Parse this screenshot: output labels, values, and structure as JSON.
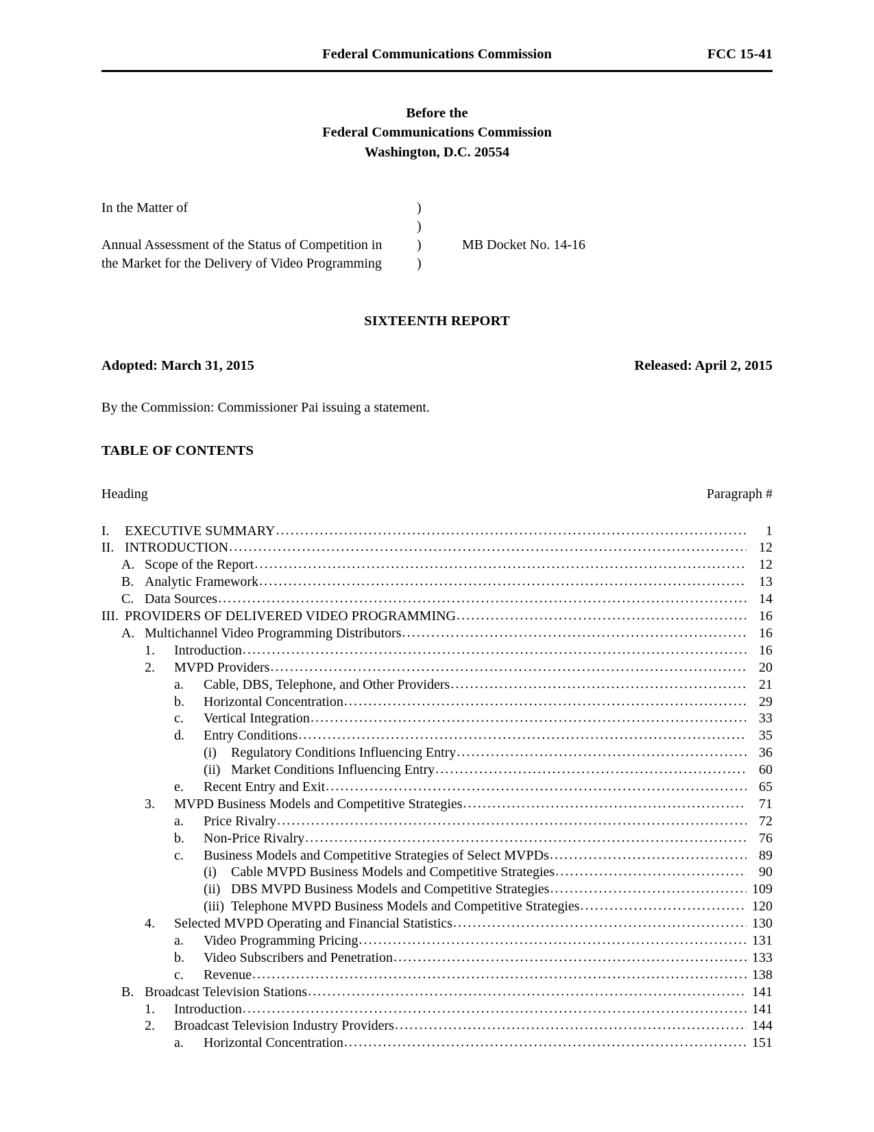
{
  "running_header": {
    "center": "Federal Communications Commission",
    "right": "FCC 15-41"
  },
  "caption": {
    "line1": "Before the",
    "line2": "Federal Communications Commission",
    "line3": "Washington, D.C. 20554"
  },
  "matter": {
    "row1_left": "In the Matter of",
    "row1_paren": ")",
    "row2_paren": ")",
    "row3_left": "Annual Assessment of the Status of Competition in",
    "row3_paren": ")",
    "row3_docket": "MB Docket No. 14-16",
    "row4_left": "the Market for the Delivery of Video Programming",
    "row4_paren": ")"
  },
  "report_title": "SIXTEENTH REPORT",
  "dates": {
    "adopted": "Adopted:  March 31, 2015",
    "released": "Released:  April 2, 2015"
  },
  "by_line": "By the Commission:  Commissioner Pai issuing a statement.",
  "toc_title": "TABLE OF CONTENTS",
  "toc_columns": {
    "heading": "Heading",
    "paragraph": "Paragraph #"
  },
  "toc": [
    {
      "level": 1,
      "num": "I.",
      "text": "EXECUTIVE SUMMARY",
      "page": "1"
    },
    {
      "level": 1,
      "num": "II.",
      "text": "INTRODUCTION",
      "page": "12"
    },
    {
      "level": 2,
      "num": "A.",
      "text": "Scope of the Report",
      "page": "12"
    },
    {
      "level": 2,
      "num": "B.",
      "text": "Analytic Framework",
      "page": "13"
    },
    {
      "level": 2,
      "num": "C.",
      "text": "Data Sources",
      "page": "14"
    },
    {
      "level": 1,
      "num": "III.",
      "text": "PROVIDERS OF DELIVERED VIDEO PROGRAMMING",
      "page": "16"
    },
    {
      "level": 2,
      "num": "A.",
      "text": "Multichannel Video Programming Distributors",
      "page": "16"
    },
    {
      "level": 3,
      "num": "1.",
      "text": "Introduction",
      "page": "16"
    },
    {
      "level": 3,
      "num": "2.",
      "text": "MVPD Providers",
      "page": "20"
    },
    {
      "level": 4,
      "num": "a.",
      "text": "Cable, DBS, Telephone, and Other Providers",
      "page": "21"
    },
    {
      "level": 4,
      "num": "b.",
      "text": "Horizontal Concentration",
      "page": "29"
    },
    {
      "level": 4,
      "num": "c.",
      "text": "Vertical Integration",
      "page": "33"
    },
    {
      "level": 4,
      "num": "d.",
      "text": "Entry Conditions",
      "page": "35"
    },
    {
      "level": 5,
      "num": "(i)",
      "text": "Regulatory Conditions Influencing Entry",
      "page": "36"
    },
    {
      "level": 5,
      "num": "(ii)",
      "text": "Market Conditions Influencing Entry",
      "page": "60"
    },
    {
      "level": 4,
      "num": "e.",
      "text": "Recent Entry and Exit",
      "page": "65"
    },
    {
      "level": 3,
      "num": "3.",
      "text": "MVPD Business Models and Competitive Strategies",
      "page": "71"
    },
    {
      "level": 4,
      "num": "a.",
      "text": "Price Rivalry",
      "page": "72"
    },
    {
      "level": 4,
      "num": "b.",
      "text": "Non-Price Rivalry",
      "page": "76"
    },
    {
      "level": 4,
      "num": "c.",
      "text": "Business Models and Competitive Strategies of Select MVPDs",
      "page": "89"
    },
    {
      "level": 5,
      "num": "(i)",
      "text": "Cable MVPD Business Models and Competitive Strategies",
      "page": "90"
    },
    {
      "level": 5,
      "num": "(ii)",
      "text": "DBS MVPD Business Models and Competitive Strategies",
      "page": "109"
    },
    {
      "level": 5,
      "num": "(iii)",
      "text": "Telephone MVPD Business Models and Competitive Strategies",
      "page": "120"
    },
    {
      "level": 3,
      "num": "4.",
      "text": "Selected MVPD Operating and Financial Statistics",
      "page": "130"
    },
    {
      "level": 4,
      "num": "a.",
      "text": "Video Programming Pricing",
      "page": "131"
    },
    {
      "level": 4,
      "num": "b.",
      "text": "Video Subscribers and Penetration",
      "page": "133"
    },
    {
      "level": 4,
      "num": "c.",
      "text": "Revenue",
      "page": "138"
    },
    {
      "level": 2,
      "num": "B.",
      "text": "Broadcast Television Stations",
      "page": "141"
    },
    {
      "level": 3,
      "num": "1.",
      "text": "Introduction",
      "page": "141"
    },
    {
      "level": 3,
      "num": "2.",
      "text": "Broadcast Television Industry Providers",
      "page": "144"
    },
    {
      "level": 4,
      "num": "a.",
      "text": "Horizontal Concentration",
      "page": "151"
    }
  ]
}
